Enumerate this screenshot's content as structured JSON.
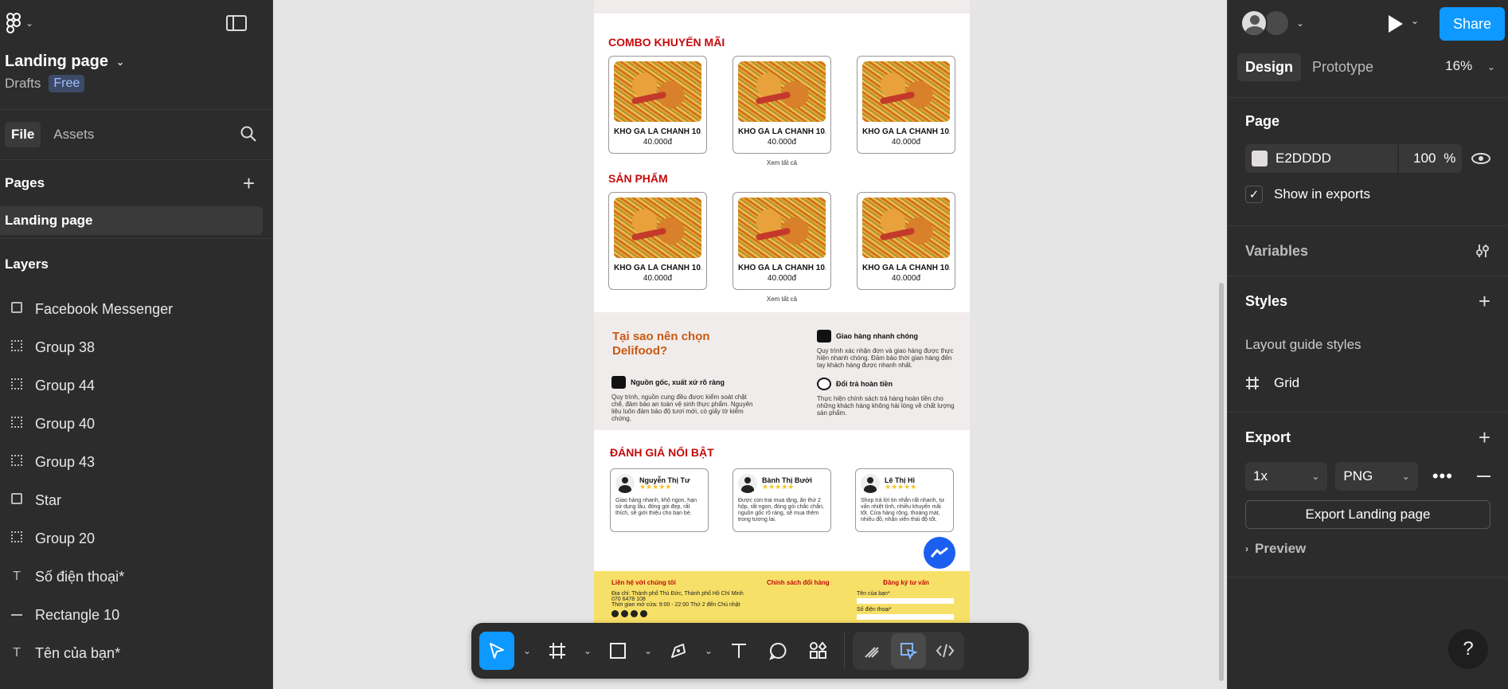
{
  "left_panel": {
    "file_title": "Landing page",
    "location": "Drafts",
    "plan_badge": "Free",
    "tabs": {
      "file": "File",
      "assets": "Assets"
    },
    "pages_heading": "Pages",
    "pages": [
      "Landing page"
    ],
    "layers_heading": "Layers",
    "layers": [
      {
        "label": "Facebook Messenger",
        "icon": "image-layer-icon"
      },
      {
        "label": "Group 38",
        "icon": "group-layer-icon"
      },
      {
        "label": "Group 44",
        "icon": "group-layer-icon"
      },
      {
        "label": "Group 40",
        "icon": "group-layer-icon"
      },
      {
        "label": "Group 43",
        "icon": "group-layer-icon"
      },
      {
        "label": "Star",
        "icon": "image-layer-icon"
      },
      {
        "label": "Group 20",
        "icon": "group-layer-icon"
      },
      {
        "label": "Số điện thoại*",
        "icon": "text-layer-icon"
      },
      {
        "label": "Rectangle 10",
        "icon": "line-layer-icon"
      },
      {
        "label": "Tên của bạn*",
        "icon": "text-layer-icon"
      }
    ]
  },
  "canvas": {
    "background": "#E5E5E5",
    "frame": {
      "promo_title": "COMBO KHUYẾN MÃI",
      "promo_cards": [
        {
          "name": "KHÔ GÀ LÁ CHANH 10...",
          "price": "40.000đ"
        },
        {
          "name": "KHÔ GÀ LÁ CHANH 10...",
          "price": "40.000đ"
        },
        {
          "name": "KHÔ GÀ LÁ CHANH 10...",
          "price": "40.000đ"
        }
      ],
      "see_all": "Xem tất cả",
      "products_title": "SẢN PHẨM",
      "product_cards": [
        {
          "name": "KHÔ GÀ LÁ CHANH 10...",
          "price": "40.000đ"
        },
        {
          "name": "KHÔ GÀ LÁ CHANH 10...",
          "price": "40.000đ"
        },
        {
          "name": "KHÔ GÀ LÁ CHANH 10...",
          "price": "40.000đ"
        }
      ],
      "why_title": "Tại sao nên chọn Delifood?",
      "features": [
        {
          "title": "Giao hàng nhanh chóng",
          "text": "Quy trình xác nhận đơn và giao hàng được thực hiện nhanh chóng. Đảm bảo thời gian hàng đến tay khách hàng được nhanh nhất."
        },
        {
          "title": "Nguồn gốc, xuất xứ rõ ràng",
          "text": "Quy trình, nguồn cung đều được kiểm soát chặt chẽ, đảm bảo an toàn vệ sinh thực phẩm. Nguyên liệu luôn đảm bảo độ tươi mới, có giấy tờ kiểm chứng."
        },
        {
          "title": "Đổi trả hoàn tiền",
          "text": "Thực hiện chính sách trả hàng hoàn tiền cho những khách hàng không hài lòng về chất lượng sản phẩm."
        }
      ],
      "reviews_title": "ĐÁNH GIÁ NỔI BẬT",
      "reviews": [
        {
          "name": "Nguyễn Thị Tư",
          "stars": "★★★★★",
          "text": "Giao hàng nhanh, khô ngon, hạn sử dụng lâu, đóng gói đẹp, rất thích, sẽ giới thiệu cho bạn bè."
        },
        {
          "name": "Bành Thị Bưởi",
          "stars": "★★★★★",
          "text": "Được con trai mua tặng, ăn thử 2 hộp, rất ngon, đóng gói chắc chắn, nguồn gốc rõ ràng, sẽ mua thêm trong tương lai."
        },
        {
          "name": "Lê Thị Hi",
          "stars": "★★★★★",
          "text": "Shop trả lời tin nhắn rất nhanh, tư vấn nhiệt tình, nhiều khuyến mãi tốt. Cửa hàng rộng, thoáng mát, nhiều đồ, nhân viên thái độ tốt."
        }
      ],
      "footer": {
        "contact_title": "Liên hệ với chúng tôi",
        "address": "Địa chỉ: Thành phố Thủ Đức, Thành phố Hồ Chí Minh",
        "phone": "070 6478 108",
        "hours": "Thời gian mở cửa: 9:00 - 22:00 Thứ 2 đến Chủ nhật",
        "policy_title": "Chính sách đổi hàng",
        "signup_title": "Đăng ký tư vấn",
        "name_label": "Tên của bạn*",
        "phone_label": "Số điện thoại*"
      }
    }
  },
  "toolbar": {
    "tools": [
      "move-tool",
      "frame-tool",
      "shape-tool",
      "pen-tool",
      "text-tool",
      "comment-tool",
      "actions-tool"
    ],
    "modes": [
      "draw-mode",
      "design-mode",
      "dev-mode"
    ]
  },
  "right_panel": {
    "share_label": "Share",
    "tabs": {
      "design": "Design",
      "prototype": "Prototype"
    },
    "zoom": "16%",
    "page_heading": "Page",
    "page_fill": "E2DDDD",
    "page_fill_color": "#E2DDDD",
    "page_opacity": "100",
    "percent": "%",
    "show_in_exports": "Show in exports",
    "variables_heading": "Variables",
    "styles_heading": "Styles",
    "layout_guide_styles": "Layout guide styles",
    "grid_label": "Grid",
    "export_heading": "Export",
    "export_scale": "1x",
    "export_format": "PNG",
    "export_button": "Export Landing page",
    "preview_label": "Preview",
    "help": "?"
  },
  "colors": {
    "accent": "#0D99FF",
    "panel_bg": "#2C2C2C",
    "heading_red": "#C40B0B",
    "footer_yellow": "#F7E067"
  }
}
